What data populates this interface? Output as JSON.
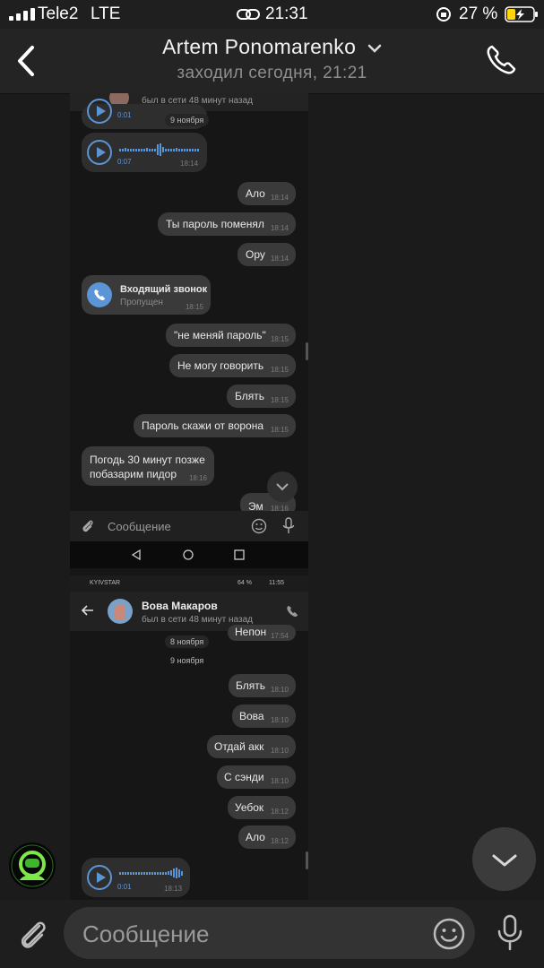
{
  "status_bar": {
    "carrier": "Tele2",
    "network": "LTE",
    "time": "21:31",
    "battery": "27 %"
  },
  "header": {
    "back_icon": "chevron-left-icon",
    "title": "Artem Ponomarenko",
    "subtitle": "заходил сегодня, 21:21",
    "call_icon": "phone-icon"
  },
  "screenshot": {
    "top_status": "был в сети 48 минут назад",
    "voice_1": {
      "duration": "0:01",
      "date_chip": "9 ноября"
    },
    "voice_2": {
      "duration": "0:07",
      "time": "18:14"
    },
    "messages": [
      {
        "text": "Ало",
        "time": "18:14"
      },
      {
        "text": "Ты пароль поменял",
        "time": "18:14"
      },
      {
        "text": "Ору",
        "time": "18:14"
      }
    ],
    "call": {
      "title": "Входящий звонок",
      "status": "Пропущен",
      "time": "18:15"
    },
    "messages_2": [
      {
        "text": "\"не меняй пароль\"",
        "time": "18:15"
      },
      {
        "text": "Не могу говорить",
        "time": "18:15"
      },
      {
        "text": "Блять",
        "time": "18:15"
      },
      {
        "text": "Пароль скажи от ворона",
        "time": "18:15"
      }
    ],
    "incoming": {
      "line1": "Погодь 30 минут позже",
      "line2": "побазарим пидор",
      "time": "18:16"
    },
    "partial": {
      "text": "Эм",
      "time": "18:16"
    },
    "composer_placeholder": "Сообщение",
    "android_status": {
      "carrier": "KYIVSTAR",
      "battery": "64 %",
      "time": "11:55"
    },
    "inner_header": {
      "name": "Вова Макаров",
      "status": "был в сети 48 минут назад"
    },
    "partial_2": {
      "text": "Непон",
      "time": "17:54"
    },
    "date_chips": [
      "8 ноября",
      "9 ноября"
    ],
    "messages_3": [
      {
        "text": "Блять",
        "time": "18:10"
      },
      {
        "text": "Вова",
        "time": "18:10"
      },
      {
        "text": "Отдай акк",
        "time": "18:10"
      },
      {
        "text": "С сэнди",
        "time": "18:10"
      },
      {
        "text": "Уебок",
        "time": "18:12"
      },
      {
        "text": "Ало",
        "time": "18:12"
      }
    ],
    "voice_3": {
      "duration": "0:01",
      "time": "18:13"
    }
  },
  "composer": {
    "placeholder": "Сообщение",
    "attach_icon": "paperclip-icon",
    "emoji_icon": "smiley-icon",
    "mic_icon": "microphone-icon"
  },
  "scroll_down_icon": "chevron-down-icon"
}
